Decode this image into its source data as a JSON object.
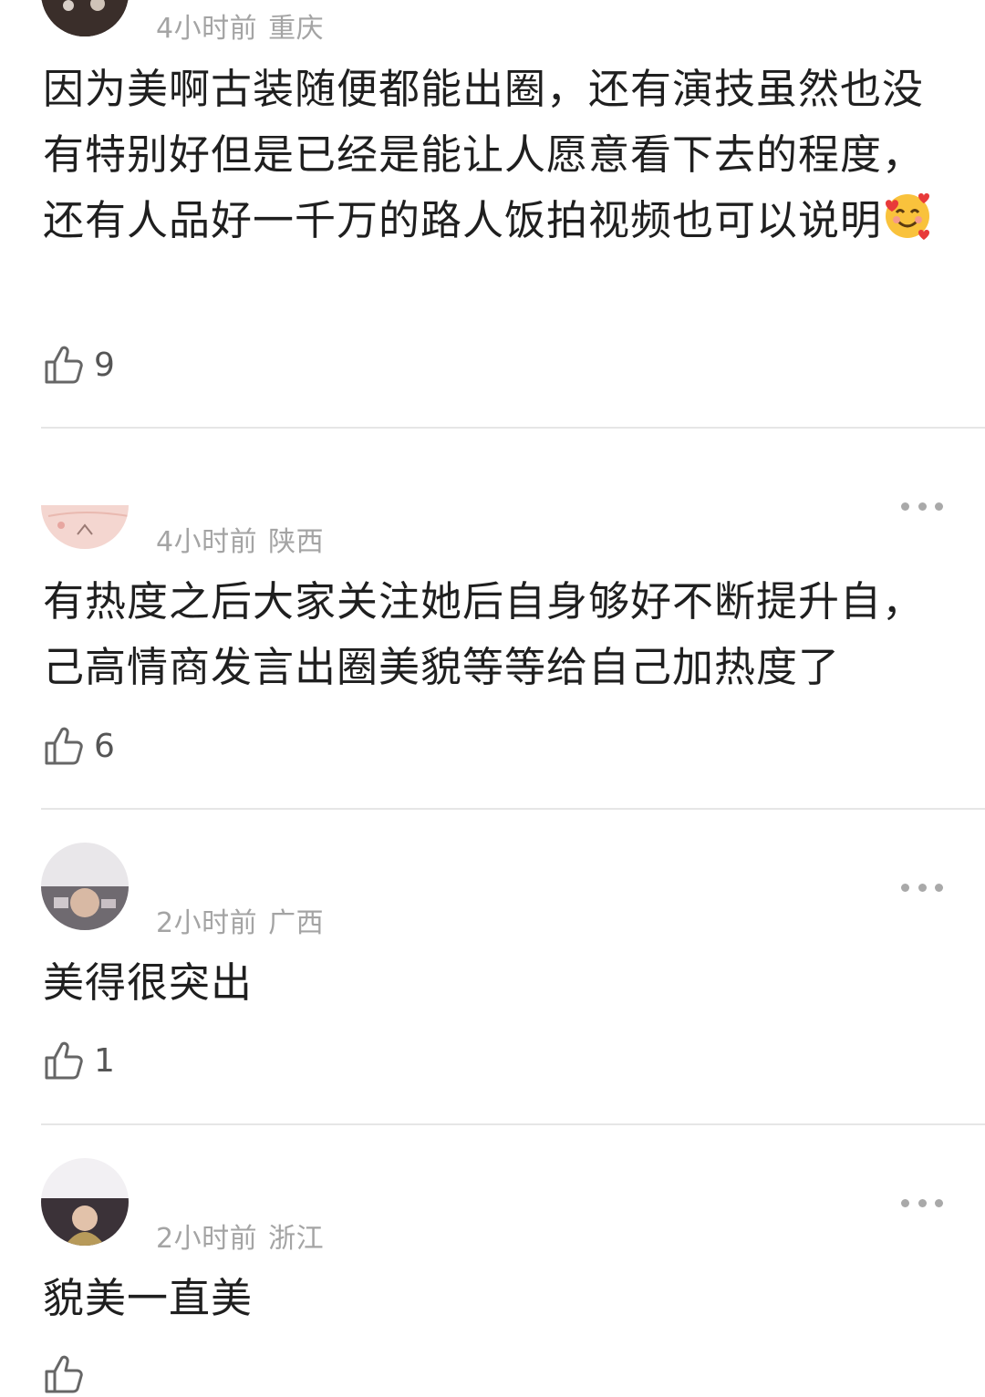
{
  "comments": [
    {
      "time": "4小时前",
      "location": "重庆",
      "text": "因为美啊古装随便都能出圈，还有演技虽然也没有特别好但是已经是能让人愿意看下去的程度，还有人品好一千万的路人饭拍视频也可以说明",
      "emoji": "smiling-face-with-hearts-icon",
      "likes": "9"
    },
    {
      "time": "4小时前",
      "location": "陕西",
      "text": "有热度之后大家关注她后自身够好不断提升自，己高情商发言出圈美貌等等给自己加热度了",
      "likes": "6"
    },
    {
      "time": "2小时前",
      "location": "广西",
      "text": "美得很突出",
      "likes": "1"
    },
    {
      "time": "2小时前",
      "location": "浙江",
      "text": "貌美一直美"
    }
  ],
  "colors": {
    "meta": "#a4a4a4",
    "text": "#1f1f1f",
    "divider": "#e6e6e6"
  }
}
